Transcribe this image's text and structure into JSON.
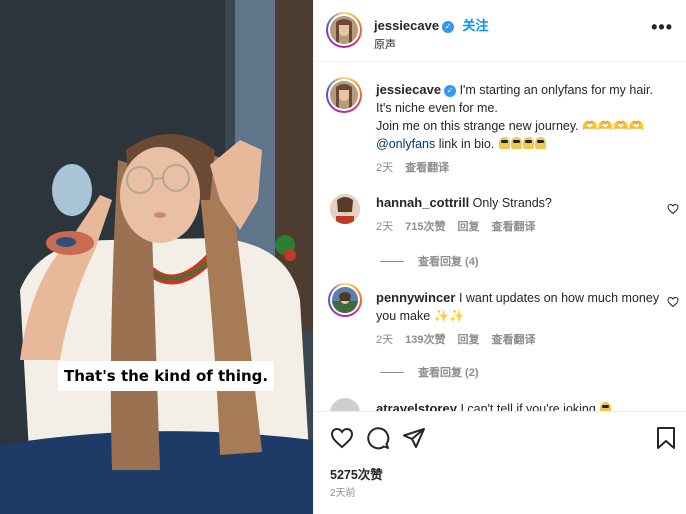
{
  "video": {
    "caption": "That's the kind of thing."
  },
  "header": {
    "username": "jessiecave",
    "follow_label": "关注",
    "subtitle": "原声",
    "more_label": "•••"
  },
  "post_caption": {
    "username": "jessiecave",
    "lines": [
      "I'm starting an onlyfans for my hair.",
      "It's niche even for me.",
      "Join me on this strange new journey. 🫶🫶🫶🫶"
    ],
    "mention": "@onlyfans",
    "mention_suffix": " link in bio.",
    "time": "2天",
    "translate": "查看翻译"
  },
  "comments": [
    {
      "username": "hannah_cottrill",
      "text": "Only Strands?",
      "time": "2天",
      "likes": "715次赞",
      "reply": "回复",
      "translate": "查看翻译",
      "view_replies": "查看回复 (4)"
    },
    {
      "username": "pennywincer",
      "text": "I want updates on how much money you make",
      "emoji": "✨✨",
      "time": "2天",
      "likes": "139次赞",
      "reply": "回复",
      "translate": "查看翻译",
      "view_replies": "查看回复 (2)"
    },
    {
      "username": "atravelstorey",
      "text": "I can't tell if you're joking"
    }
  ],
  "actions": {
    "likes": "5275次赞",
    "posted": "2天前"
  },
  "colors": {
    "link_blue": "#0095f6",
    "mention_blue": "#00376b",
    "muted": "#8e8e8e"
  }
}
